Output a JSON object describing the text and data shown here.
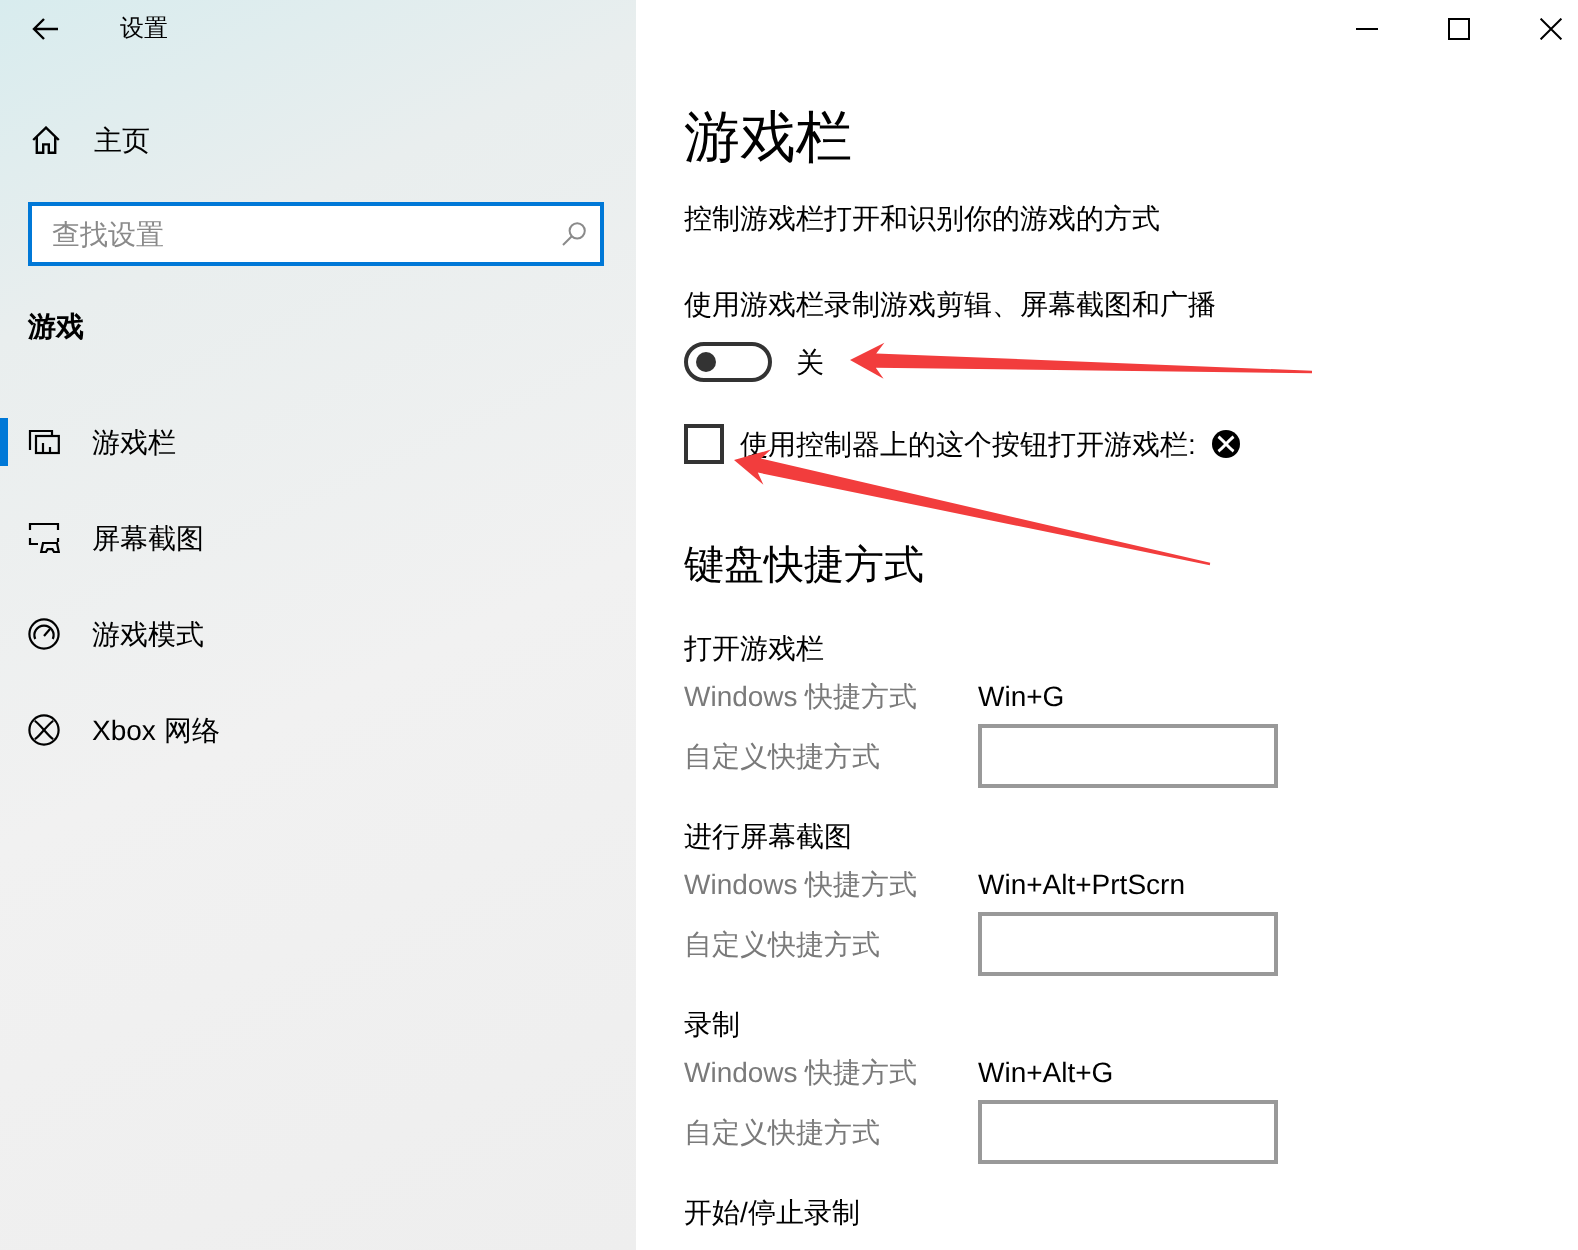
{
  "window": {
    "title": "设置"
  },
  "sidebar": {
    "home": "主页",
    "search": {
      "placeholder": "查找设置"
    },
    "section": "游戏",
    "items": [
      {
        "kind": "gamebar",
        "label": "游戏栏",
        "selected": true
      },
      {
        "kind": "capture",
        "label": "屏幕截图",
        "selected": false
      },
      {
        "kind": "gamemode",
        "label": "游戏模式",
        "selected": false
      },
      {
        "kind": "xbox",
        "label": "Xbox 网络",
        "selected": false
      }
    ]
  },
  "page": {
    "title": "游戏栏",
    "description": "控制游戏栏打开和识别你的游戏的方式",
    "record_setting": {
      "label": "使用游戏栏录制游戏剪辑、屏幕截图和广播",
      "on": false,
      "state_text": "关",
      "arrow_marked": true
    },
    "controller_setting": {
      "label": "使用控制器上的这个按钮打开游戏栏:",
      "checked": false,
      "arrow_marked": true
    },
    "shortcuts": {
      "title": "键盘快捷方式",
      "groups": [
        {
          "title": "打开游戏栏",
          "windows_label": "Windows 快捷方式",
          "windows_value": "Win+G",
          "custom_label": "自定义快捷方式"
        },
        {
          "title": "进行屏幕截图",
          "windows_label": "Windows 快捷方式",
          "windows_value": "Win+Alt+PrtScrn",
          "custom_label": "自定义快捷方式"
        },
        {
          "title": "录制",
          "windows_label": "Windows 快捷方式",
          "windows_value": "Win+Alt+G",
          "custom_label": "自定义快捷方式"
        },
        {
          "title": "开始/停止录制"
        }
      ]
    }
  }
}
